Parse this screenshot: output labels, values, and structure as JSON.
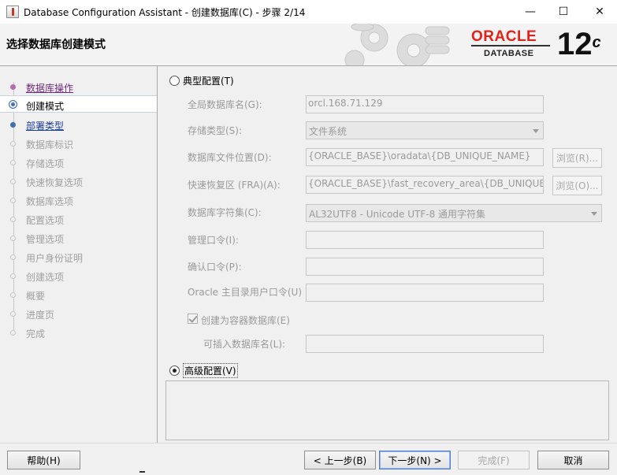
{
  "window": {
    "title": "Database Configuration Assistant - 创建数据库(C) - 步骤 2/14",
    "minimize": "—",
    "maximize": "☐",
    "close": "✕"
  },
  "header": {
    "title": "选择数据库创建模式",
    "logo_word": "ORACLE",
    "logo_reg": "®",
    "logo_sub": "DATABASE",
    "version": "12",
    "version_sup": "c"
  },
  "nav": {
    "items": [
      {
        "label": "数据库操作",
        "state": "done"
      },
      {
        "label": "创建模式",
        "state": "current"
      },
      {
        "label": "部署类型",
        "state": "link"
      },
      {
        "label": "数据库标识",
        "state": "pending"
      },
      {
        "label": "存储选项",
        "state": "pending"
      },
      {
        "label": "快速恢复选项",
        "state": "pending"
      },
      {
        "label": "数据库选项",
        "state": "pending"
      },
      {
        "label": "配置选项",
        "state": "pending"
      },
      {
        "label": "管理选项",
        "state": "pending"
      },
      {
        "label": "用户身份证明",
        "state": "pending"
      },
      {
        "label": "创建选项",
        "state": "pending"
      },
      {
        "label": "概要",
        "state": "pending"
      },
      {
        "label": "进度页",
        "state": "pending"
      },
      {
        "label": "完成",
        "state": "pending"
      }
    ]
  },
  "typical": {
    "label": "典型配置(T)",
    "selected": false,
    "global_db_name_label": "全局数据库名(G):",
    "global_db_name_value": "orcl.168.71.129",
    "storage_type_label": "存储类型(S):",
    "storage_type_value": "文件系统",
    "db_file_location_label": "数据库文件位置(D):",
    "db_file_location_value": "{ORACLE_BASE}\\oradata\\{DB_UNIQUE_NAME}",
    "browse_r_label": "浏览(R)...",
    "fra_label": "快速恢复区 (FRA)(A):",
    "fra_value": "{ORACLE_BASE}\\fast_recovery_area\\{DB_UNIQUE_NAME}",
    "browse_o_label": "浏览(O)...",
    "charset_label": "数据库字符集(C):",
    "charset_value": "AL32UTF8 - Unicode UTF-8 通用字符集",
    "admin_password_label": "管理口令(I):",
    "admin_password_value": "",
    "confirm_password_label": "确认口令(P):",
    "confirm_password_value": "",
    "oracle_home_password_label": "Oracle 主目录用户口令(U)",
    "oracle_home_password_value": "",
    "container_db_label": "创建为容器数据库(E)",
    "container_db_checked": true,
    "pluggable_db_label": "可插入数据库名(L):",
    "pluggable_db_value": ""
  },
  "advanced": {
    "label": "高级配置(V)",
    "selected": true
  },
  "footer": {
    "help_label": "帮助(H)",
    "back_label": "< 上一步(B)",
    "next_label": "下一步(N) >",
    "finish_label": "完成(F)",
    "cancel_label": "取消"
  }
}
